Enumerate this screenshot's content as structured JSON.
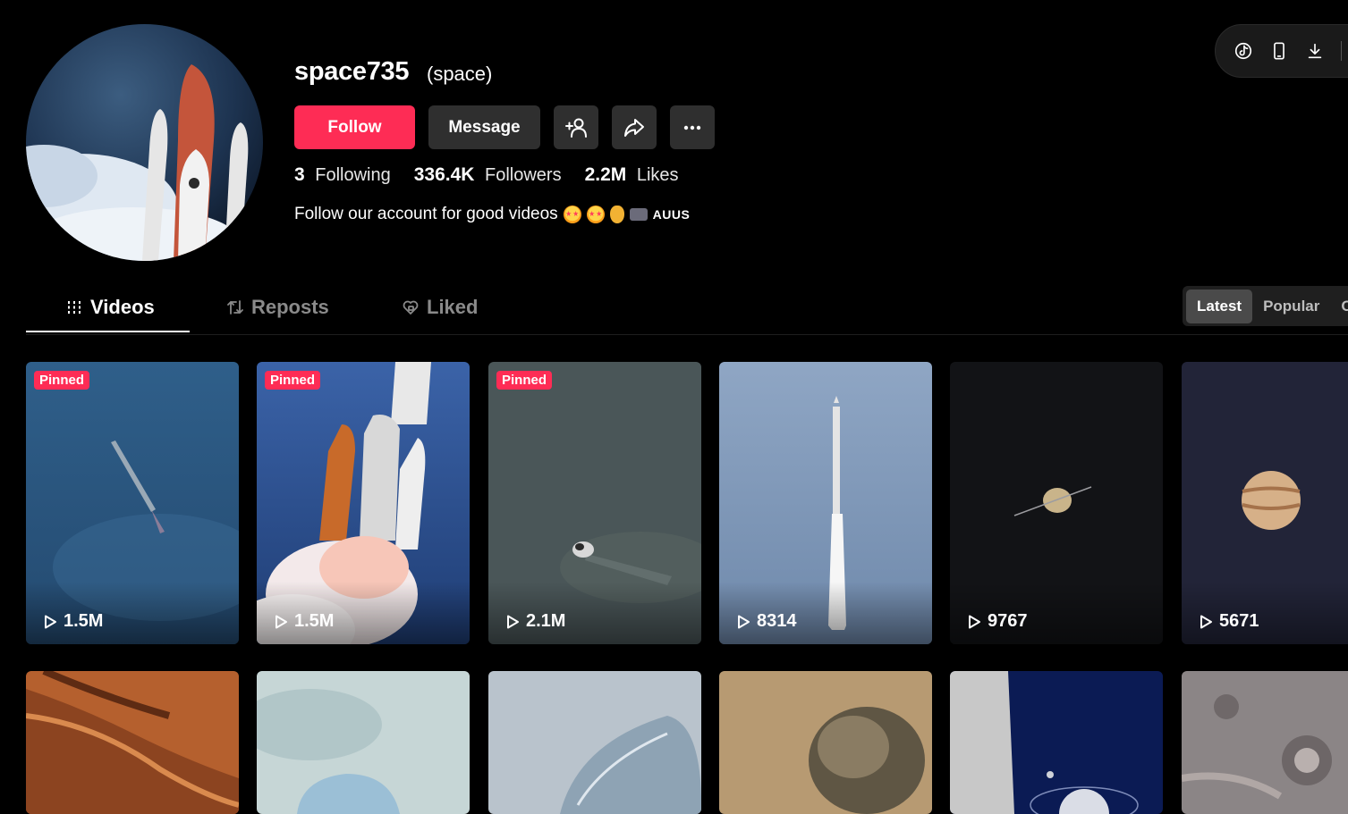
{
  "profile": {
    "username": "space735",
    "nickname": "(space)",
    "follow_label": "Follow",
    "message_label": "Message",
    "stats": {
      "following_count": "3",
      "following_label": "Following",
      "followers_count": "336.4K",
      "followers_label": "Followers",
      "likes_count": "2.2M",
      "likes_label": "Likes"
    },
    "bio": "Follow our account for good videos",
    "bio_tag": "AUUS",
    "bio_emojis": [
      "star-struck-emoji",
      "star-struck-emoji",
      "pinched-fingers-emoji",
      "camera-emoji"
    ]
  },
  "top_controls": {
    "icons": [
      "tiktok-icon",
      "phone-icon",
      "download-icon"
    ]
  },
  "tabs": [
    {
      "label": "Videos",
      "icon": "grid-icon",
      "active": true
    },
    {
      "label": "Reposts",
      "icon": "repost-icon",
      "active": false
    },
    {
      "label": "Liked",
      "icon": "heart-icon",
      "active": false
    }
  ],
  "sort": {
    "options": [
      "Latest",
      "Popular",
      "O"
    ],
    "selected": "Latest"
  },
  "videos": [
    {
      "pinned": true,
      "pinned_label": "Pinned",
      "views": "1.5M",
      "theme": "rocket in blue sky"
    },
    {
      "pinned": true,
      "pinned_label": "Pinned",
      "views": "1.5M",
      "theme": "space shuttle launch"
    },
    {
      "pinned": true,
      "pinned_label": "Pinned",
      "views": "2.1M",
      "theme": "capsule in grey sky"
    },
    {
      "pinned": false,
      "views": "8314",
      "theme": "rocket ascent"
    },
    {
      "pinned": false,
      "views": "9767",
      "theme": "saturn"
    },
    {
      "pinned": false,
      "views": "5671",
      "theme": "jupiter"
    },
    {
      "pinned": false,
      "views": "",
      "theme": "mars canyon"
    },
    {
      "pinned": false,
      "views": "",
      "theme": "ice planet"
    },
    {
      "pinned": false,
      "views": "",
      "theme": "frozen sphere"
    },
    {
      "pinned": false,
      "views": "",
      "theme": "moon surface"
    },
    {
      "pinned": false,
      "views": "",
      "theme": "planet horizon"
    },
    {
      "pinned": false,
      "views": "",
      "theme": "crater surface"
    }
  ],
  "colors": {
    "accent": "#fe2c55",
    "background": "#000000",
    "button_secondary": "#2f2f2f"
  }
}
